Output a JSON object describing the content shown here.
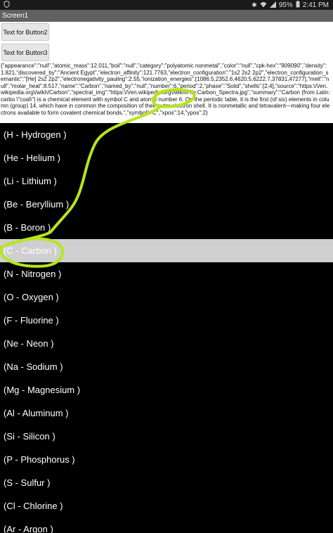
{
  "status_bar": {
    "battery": "95%",
    "time": "2:41 PM",
    "icons": [
      "shield-icon",
      "bluetooth-icon",
      "wifi-icon",
      "signal-icon",
      "battery-icon"
    ]
  },
  "screen_title": "Screen1",
  "buttons": {
    "button2_label": "Text for Button2",
    "button3_label": "Text for Button3"
  },
  "json_text": "{\"appearance\":\"null\",\"atomic_mass\":12.011,\"boil\":\"null\",\"category\":\"polyatomic nonmetal\",\"color\":\"null\",\"cpk-hex\":\"909090\",\"density\":1.821,\"discovered_by\":\"Ancient Egypt\",\"electron_affinity\":121.7763,\"electron_configuration\":\"1s2 2s2 2p2\",\"electron_configuration_semantic\":\"[He] 2s2 2p2\",\"electronegativity_pauling\":2.55,\"ionization_energies\":[1086.5,2352.6,4620.5,6222.7,37831,47277],\"melt\":\"null\",\"molar_heat\":8.517,\"name\":\"Carbon\",\"named_by\":\"null\",\"number\":6,\"period\":2,\"phase\":\"Solid\",\"shells\":[2,4],\"source\":\"https:\\/\\/en.wikipedia.org\\/wiki\\/Carbon\",\"spectral_img\":\"https:\\/\\/en.wikipedia.org\\/wiki\\/File:Carbon_Spectra.jpg\",\"summary\":\"Carbon (from Latin:carbo \\\"coal\\\") is a chemical element with symbol C and atomic number 6. On the periodic table, it is the first (of six) elements in column (group) 14, which have in common the composition of their outer electron shell. It is nonmetallic and tetravalent—making four electrons available to form covalent chemical bonds.\",\"symbol\":\"C\",\"xpos\":14,\"ypos\":2}",
  "elements": [
    {
      "label": "(H - Hydrogen )",
      "selected": false
    },
    {
      "label": "(He - Helium )",
      "selected": false
    },
    {
      "label": "(Li - Lithium )",
      "selected": false
    },
    {
      "label": "(Be - Beryllium )",
      "selected": false
    },
    {
      "label": "(B - Boron )",
      "selected": false
    },
    {
      "label": "(C - Carbon )",
      "selected": true
    },
    {
      "label": "(N - Nitrogen )",
      "selected": false
    },
    {
      "label": "(O - Oxygen )",
      "selected": false
    },
    {
      "label": "(F - Fluorine )",
      "selected": false
    },
    {
      "label": "(Ne - Neon )",
      "selected": false
    },
    {
      "label": "(Na - Sodium )",
      "selected": false
    },
    {
      "label": "(Mg - Magnesium )",
      "selected": false
    },
    {
      "label": "(Al - Aluminum )",
      "selected": false
    },
    {
      "label": "(Si - Silicon )",
      "selected": false
    },
    {
      "label": "(P - Phosphorus )",
      "selected": false
    },
    {
      "label": "(S - Sulfur )",
      "selected": false
    },
    {
      "label": "(Cl - Chlorine )",
      "selected": false
    },
    {
      "label": "(Ar - Argon )",
      "selected": false
    }
  ],
  "colors": {
    "selected_row": "#cfcfcf",
    "title_bar": "#616161",
    "annotation": "#b5e61d"
  }
}
